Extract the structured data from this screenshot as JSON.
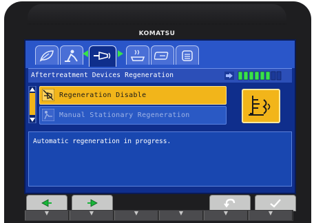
{
  "device": {
    "brand": "KOMATSU"
  },
  "tabs": [
    {
      "icon": "leaf-eco-icon",
      "active": false
    },
    {
      "icon": "service-person-icon",
      "active": false
    },
    {
      "icon": "exhaust-regeneration-icon",
      "active": true
    },
    {
      "icon": "heater-icon",
      "active": false
    },
    {
      "icon": "wrench-message-icon",
      "active": false
    },
    {
      "icon": "list-icon",
      "active": false
    }
  ],
  "header": {
    "title": "Aftertreatment Devices Regeneration",
    "soot_level": {
      "filled": 6,
      "total": 8
    }
  },
  "menu": {
    "items": [
      {
        "label": "Regeneration Disable",
        "icon": "regeneration-disable-icon",
        "selected": true
      },
      {
        "label": "Manual Stationary Regeneration",
        "icon": "manual-regeneration-icon",
        "selected": false
      }
    ]
  },
  "message": "Automatic regeneration in progress.",
  "function_keys": [
    {
      "icon": "arrow-left-icon"
    },
    {
      "icon": "arrow-right-icon"
    },
    {
      "icon": "return-icon"
    },
    {
      "icon": "checkmark-icon"
    }
  ],
  "hard_keys": [
    "▼",
    "▼",
    "▼",
    "▼",
    "▼",
    "▼"
  ],
  "colors": {
    "screen": "#0f2e8c",
    "selected": "#f2b51a",
    "accent_green": "#38e24a",
    "tab": "#4a6fd6"
  }
}
